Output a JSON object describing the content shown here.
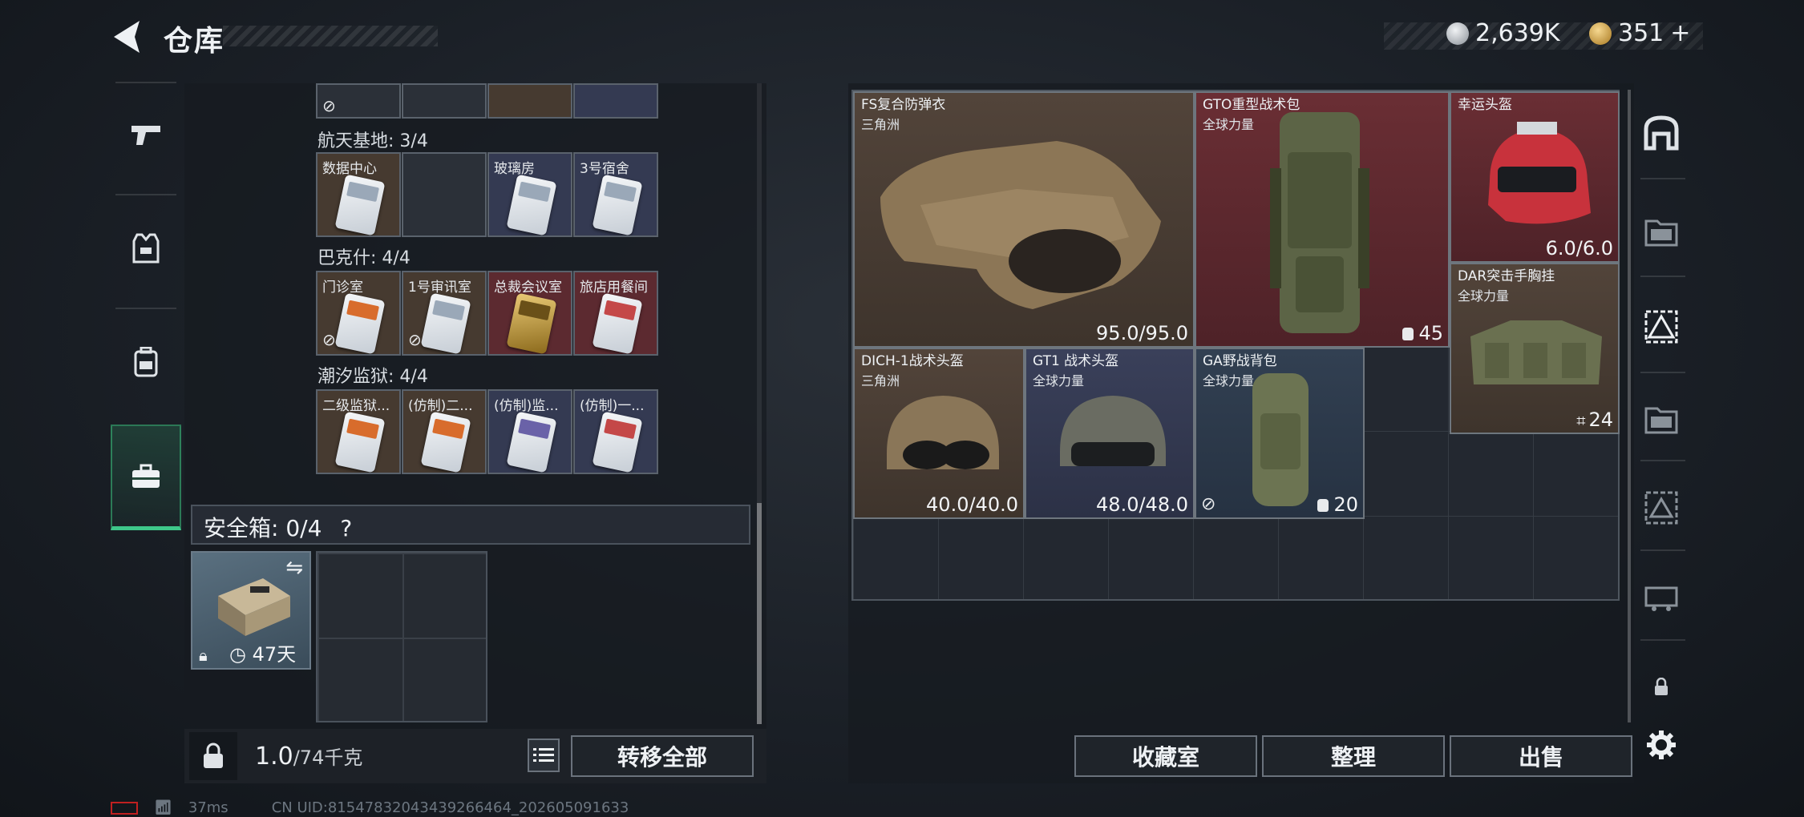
{
  "header": {
    "title": "仓库",
    "currency": [
      {
        "icon": "silver-coin-icon",
        "value": "2,639K",
        "color": "#c8ccd2"
      },
      {
        "icon": "gold-coin-icon",
        "value": "351",
        "suffix": "+",
        "color": "#e0b050"
      }
    ]
  },
  "left_nav": [
    {
      "name": "weapons",
      "icon": "pistol-icon",
      "active": false
    },
    {
      "name": "gear",
      "icon": "vest-icon",
      "active": false
    },
    {
      "name": "backpack",
      "icon": "backpack-icon",
      "active": false
    },
    {
      "name": "cases",
      "icon": "briefcase-icon",
      "active": true
    }
  ],
  "key_groups": [
    {
      "label": "航天基地: 3/4",
      "slots": [
        {
          "name": "数据中心",
          "bg": "brown",
          "card": "blue"
        },
        {
          "name": "",
          "bg": "dark",
          "card": ""
        },
        {
          "name": "玻璃房",
          "bg": "navy",
          "card": "blue"
        },
        {
          "name": "3号宿舍",
          "bg": "navy",
          "card": "blue"
        }
      ]
    },
    {
      "label": "巴克什: 4/4",
      "slots": [
        {
          "name": "门诊室",
          "bg": "brown",
          "card": "orange",
          "no_trade": true
        },
        {
          "name": "1号审讯室",
          "bg": "brown",
          "card": "blue",
          "no_trade": true
        },
        {
          "name": "总裁会议室",
          "bg": "red",
          "card": "gold"
        },
        {
          "name": "旅店用餐间",
          "bg": "red",
          "card": "red"
        }
      ]
    },
    {
      "label": "潮汐监狱: 4/4",
      "slots": [
        {
          "name": "二级监狱...",
          "bg": "brown",
          "card": "orange"
        },
        {
          "name": "(仿制)二...",
          "bg": "brown",
          "card": "orange"
        },
        {
          "name": "(仿制)监...",
          "bg": "navy",
          "card": "purple"
        },
        {
          "name": "(仿制)一...",
          "bg": "navy",
          "card": "red"
        }
      ]
    }
  ],
  "safebox": {
    "label": "安全箱: 0/4",
    "help": "?",
    "days": "47天"
  },
  "bottom_left": {
    "weight": "1.0",
    "capacity": "/74千克",
    "transfer_all": "转移全部"
  },
  "stash_items": [
    {
      "name": "FS复合防弹衣",
      "sub": "三角洲",
      "value": "95.0/95.0",
      "bg": "brown"
    },
    {
      "name": "GTO重型战术包",
      "sub": "全球力量",
      "value": "45",
      "bag": true,
      "bg": "red"
    },
    {
      "name": "幸运头盔",
      "sub": "",
      "value": "6.0/6.0",
      "bg": "red"
    },
    {
      "name": "DAR突击手胸挂",
      "sub": "全球力量",
      "value": "24",
      "rig": true,
      "bg": "brown"
    },
    {
      "name": "DICH-1战术头盔",
      "sub": "三角洲",
      "value": "40.0/40.0",
      "bg": "brown"
    },
    {
      "name": "GT1 战术头盔",
      "sub": "全球力量",
      "value": "48.0/48.0",
      "bg": "navy"
    },
    {
      "name": "GA野战背包",
      "sub": "全球力量",
      "value": "20",
      "bag": true,
      "no_trade": true,
      "bg": "blue"
    }
  ],
  "right_buttons": {
    "collection": "收藏室",
    "organize": "整理",
    "sell": "出售"
  },
  "status": {
    "ping": "37ms",
    "uid": "CN UID:8154783204343926646​4_202605091633"
  }
}
